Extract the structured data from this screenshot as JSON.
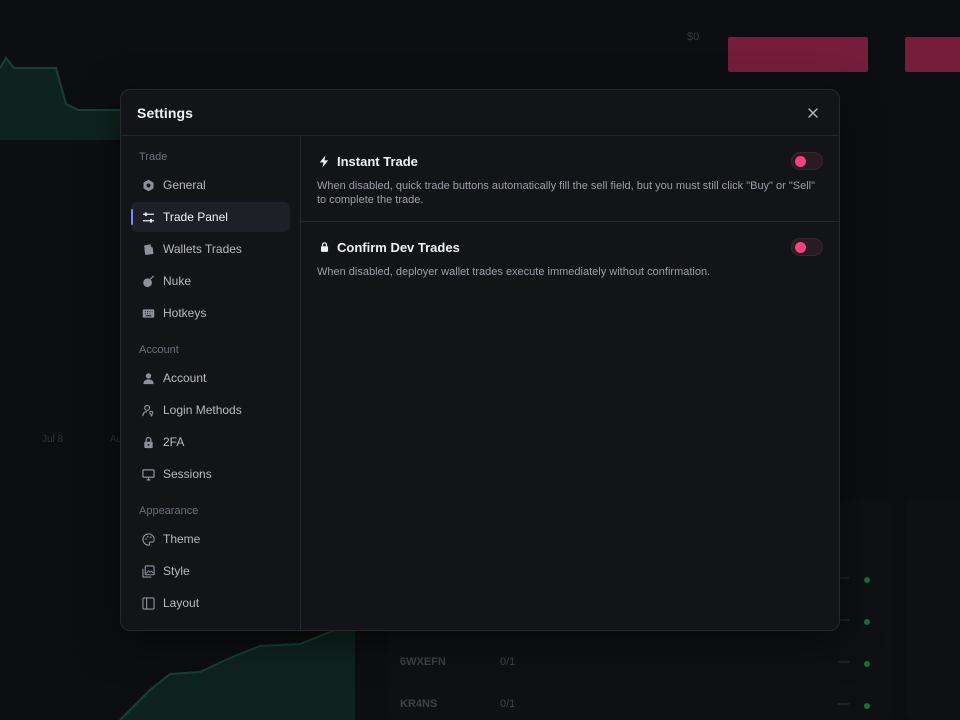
{
  "background": {
    "price_axis_label": "$0",
    "date_labels": [
      "Jul 8",
      "Au"
    ],
    "rows": [
      {
        "name": "",
        "ratio": ""
      },
      {
        "name": "",
        "ratio": ""
      },
      {
        "name": "6WXEFN",
        "ratio": "0/1"
      },
      {
        "name": "KR4NS",
        "ratio": "0/1"
      }
    ]
  },
  "modal": {
    "title": "Settings",
    "close_icon": "close-icon"
  },
  "sidebar": {
    "sections": [
      {
        "label": "Trade",
        "items": [
          {
            "label": "General",
            "icon": "hexagon-gear-icon",
            "active": false
          },
          {
            "label": "Trade Panel",
            "icon": "sliders-icon",
            "active": true
          },
          {
            "label": "Wallets Trades",
            "icon": "wallet-cards-icon",
            "active": false
          },
          {
            "label": "Nuke",
            "icon": "bomb-icon",
            "active": false
          },
          {
            "label": "Hotkeys",
            "icon": "keyboard-icon",
            "active": false
          }
        ]
      },
      {
        "label": "Account",
        "items": [
          {
            "label": "Account",
            "icon": "user-icon",
            "active": false
          },
          {
            "label": "Login Methods",
            "icon": "user-key-icon",
            "active": false
          },
          {
            "label": "2FA",
            "icon": "lock-icon",
            "active": false
          },
          {
            "label": "Sessions",
            "icon": "monitor-icon",
            "active": false
          }
        ]
      },
      {
        "label": "Appearance",
        "items": [
          {
            "label": "Theme",
            "icon": "palette-icon",
            "active": false
          },
          {
            "label": "Style",
            "icon": "image-stack-icon",
            "active": false
          },
          {
            "label": "Layout",
            "icon": "layout-icon",
            "active": false
          }
        ]
      }
    ]
  },
  "settings": [
    {
      "title": "Instant Trade",
      "icon": "lightning-icon",
      "description": "When disabled, quick trade buttons automatically fill the sell field, but you must still click \"Buy\" or \"Sell\" to complete the trade.",
      "enabled": false
    },
    {
      "title": "Confirm Dev Trades",
      "icon": "lock-icon",
      "description": "When disabled, deployer wallet trades execute immediately without confirmation.",
      "enabled": false
    }
  ],
  "colors": {
    "accent": "#7b86ff",
    "toggle_knob": "#f2447f",
    "background_bar": "#ce2f63",
    "chart_green": "#1f6f52"
  }
}
